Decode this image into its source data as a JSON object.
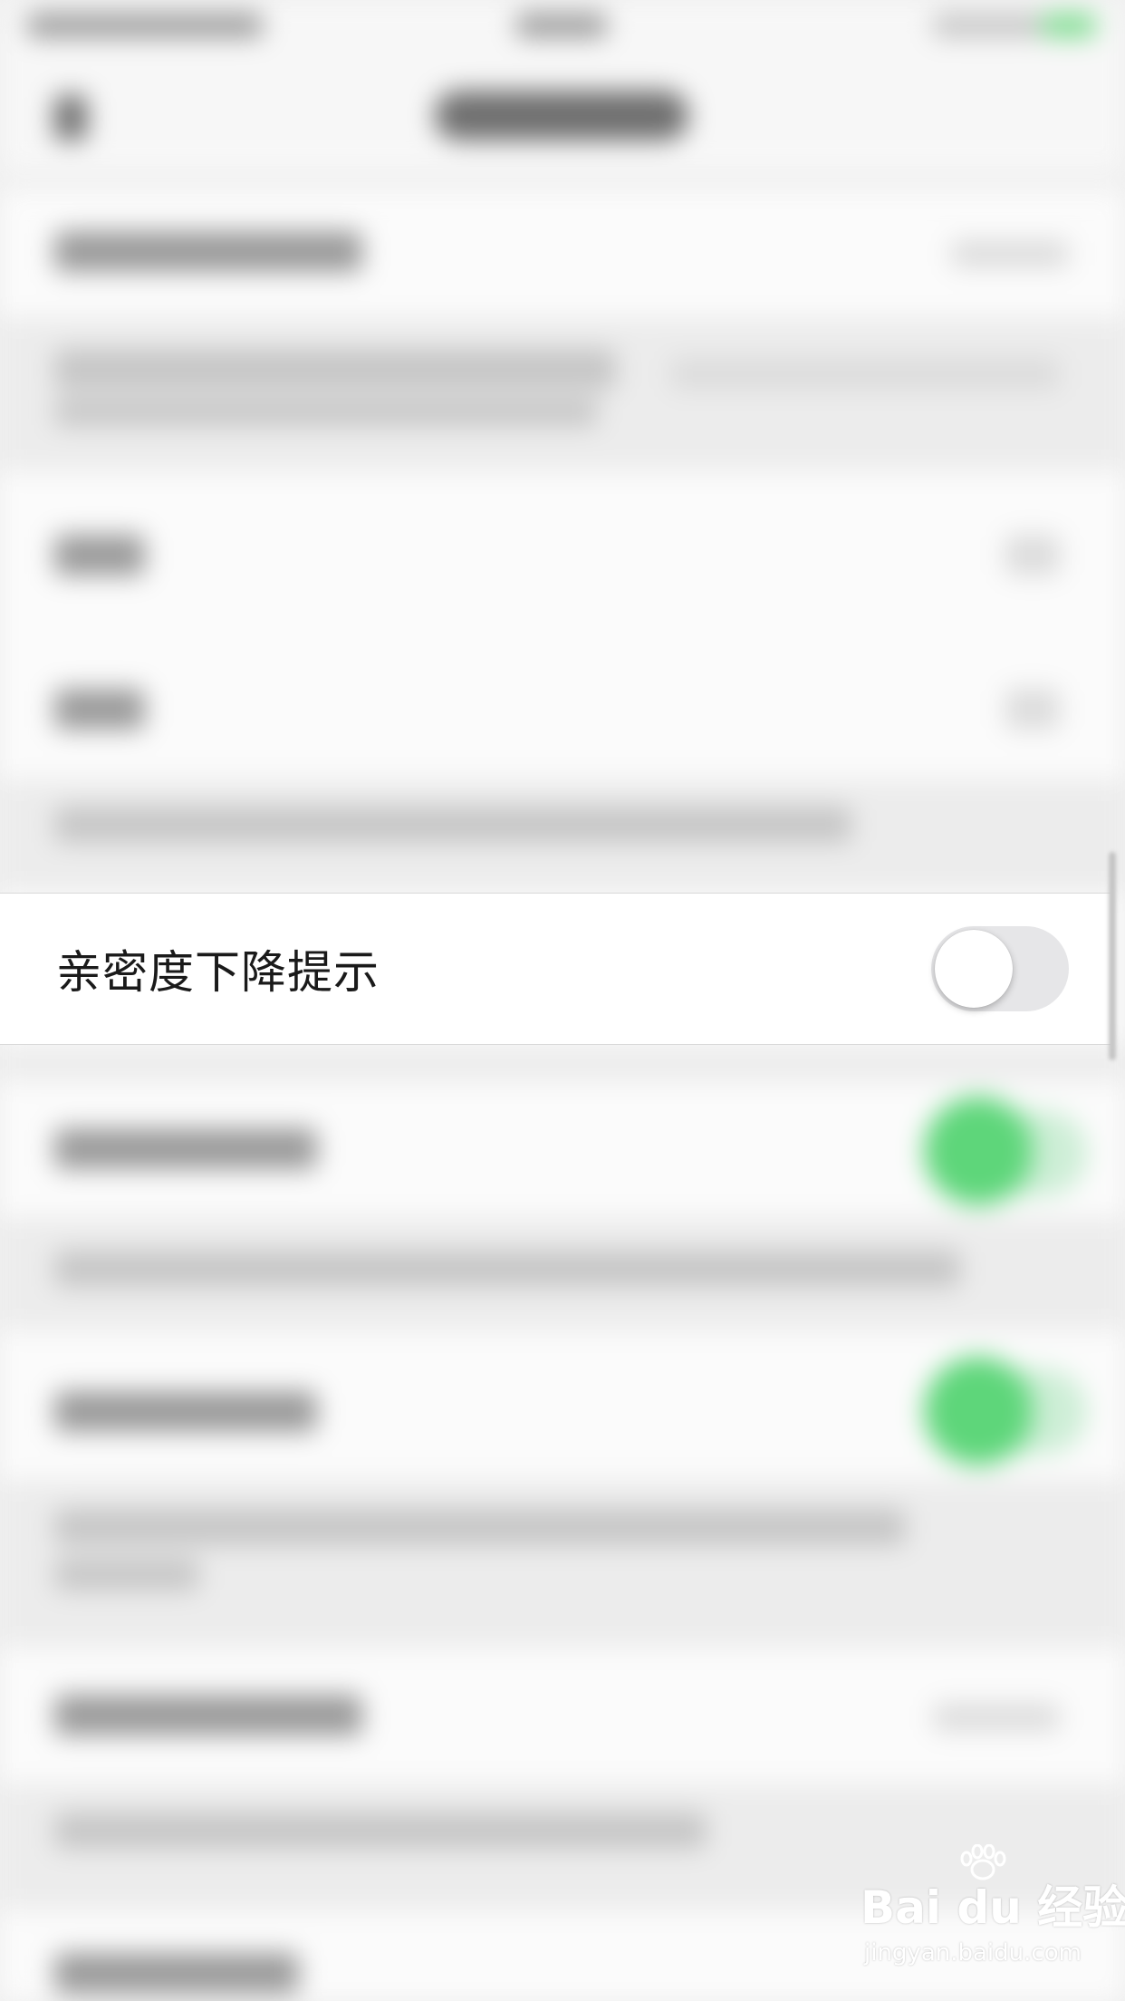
{
  "highlighted_setting": {
    "label": "亲密度下降提示",
    "enabled": false
  },
  "watermark": {
    "logo_text": "Bai du 经验",
    "site": "jingyan.baidu.com"
  }
}
